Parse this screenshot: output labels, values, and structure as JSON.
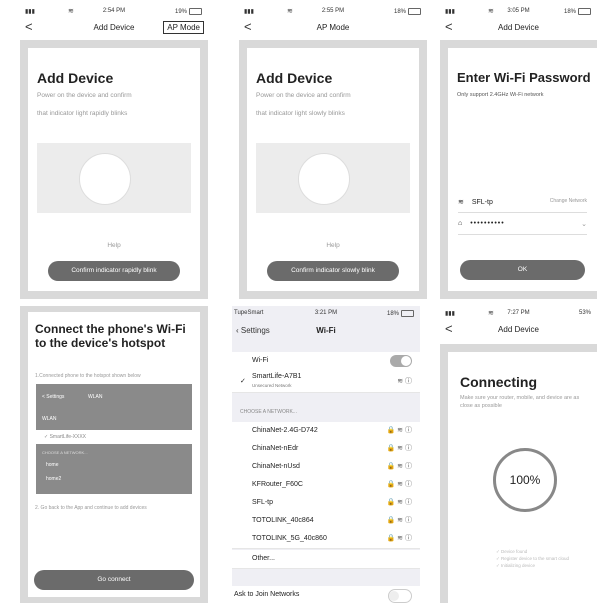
{
  "p1": {
    "status": {
      "signal": "atl",
      "time": "2:54 PM",
      "battery": "19%"
    },
    "nav": {
      "back": "<",
      "title": "Add Device",
      "right": "AP Mode"
    },
    "heading": "Add Device",
    "line1": "Power on the device and confirm",
    "line2": "that indicator light rapidly blinks",
    "help": "Help",
    "button": "Confirm indicator rapidly blink"
  },
  "p2": {
    "status": {
      "signal": "atl",
      "time": "2:55 PM",
      "battery": "18%"
    },
    "nav": {
      "back": "<",
      "title": "AP Mode"
    },
    "heading": "Add Device",
    "line1": "Power on the device and confirm",
    "line2": "that indicator light slowly blinks",
    "help": "Help",
    "button": "Confirm indicator slowly blink"
  },
  "p3": {
    "status": {
      "signal": "atl",
      "time": "3:05 PM",
      "battery": "18%"
    },
    "nav": {
      "back": "<",
      "title": "Add Device"
    },
    "heading": "Enter Wi-Fi Password",
    "note": "Only support 2.4GHz Wi-Fi network",
    "network": "SFL-tp",
    "change": "Change Network",
    "password": "••••••••••",
    "button": "OK"
  },
  "p4": {
    "heading": "Connect the phone's Wi-Fi to the device's hotspot",
    "step1": "1.Connected phone to the hotspot shown below",
    "mini": {
      "back": "< Settings",
      "title": "WLAN",
      "wlan": "WLAN",
      "ssid": "SmartLife-XXXX",
      "section": "CHOOSE A NETWORK...",
      "home1": "home",
      "home2": "home2"
    },
    "step2": "2. Go back to the App and continue to add devices",
    "button": "Go connect"
  },
  "p5": {
    "status": {
      "carrier": "TupeSmart",
      "time": "3:21 PM",
      "battery": "18%"
    },
    "nav": {
      "back": "Settings",
      "title": "Wi-Fi"
    },
    "wifi_label": "Wi-Fi",
    "connected": "SmartLife-A7B1",
    "connected_sub": "Unsecured Network",
    "section": "CHOOSE A NETWORK...",
    "networks": [
      "ChinaNet-2.4G-D742",
      "ChinaNet-nEdr",
      "ChinaNet-nUsd",
      "KFRouter_F60C",
      "SFL-tp",
      "TOTOLINK_40c864",
      "TOTOLINK_5G_40c860"
    ],
    "other": "Other...",
    "ask": "Ask to Join Networks"
  },
  "p6": {
    "status": {
      "signal": "atl",
      "time": "7:27 PM",
      "battery": "53%"
    },
    "nav": {
      "back": "<",
      "title": "Add Device"
    },
    "heading": "Connecting",
    "sub": "Make sure your router, mobile, and device are as close as possible",
    "percent": "100%",
    "progress": 1.0,
    "steps": [
      "Device found",
      "Register device to the smart cloud",
      "Initializing device"
    ]
  }
}
